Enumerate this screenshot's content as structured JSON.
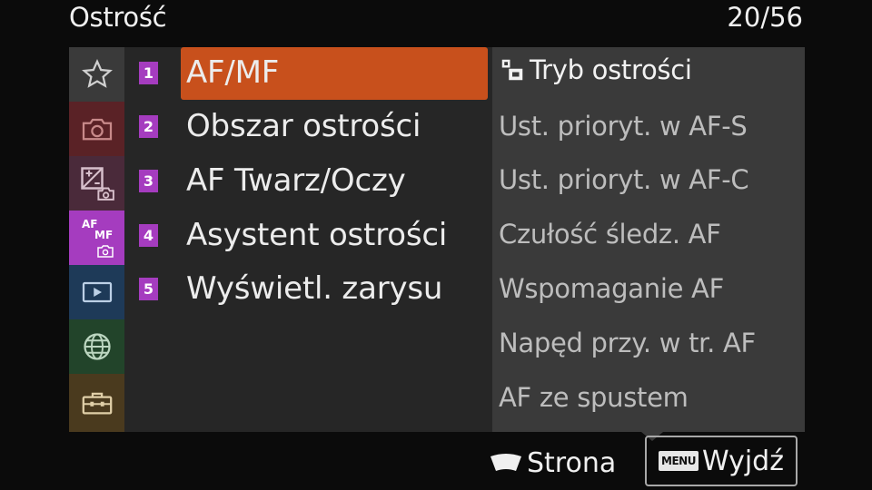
{
  "header": {
    "title": "Ostrość",
    "page": "20/56"
  },
  "tabs": [
    {
      "icon": "star-icon",
      "color": "#3a3a3a"
    },
    {
      "icon": "camera-icon",
      "color": "#5a2226"
    },
    {
      "icon": "exposure-camera-icon",
      "color": "#4a2a3a"
    },
    {
      "icon": "af-mf-camera-icon",
      "color": "#a53cbf",
      "selected": true,
      "label_top": "AF",
      "label_bottom": "MF"
    },
    {
      "icon": "playback-icon",
      "color": "#1e3a58"
    },
    {
      "icon": "globe-icon",
      "color": "#22442a"
    },
    {
      "icon": "toolbox-icon",
      "color": "#4a3a1e"
    }
  ],
  "menu": {
    "items": [
      {
        "num": "1",
        "label": "AF/MF"
      },
      {
        "num": "2",
        "label": "Obszar ostrości"
      },
      {
        "num": "3",
        "label": "AF Twarz/Oczy"
      },
      {
        "num": "4",
        "label": "Asystent ostrości"
      },
      {
        "num": "5",
        "label": "Wyświetl. zarysu"
      }
    ]
  },
  "submenu": {
    "items": [
      "Tryb ostrości",
      "Ust. prioryt. w AF-S",
      "Ust. prioryt. w AF-C",
      "Czułość śledz. AF",
      "Wspomaganie AF",
      "Napęd przy. w tr. AF",
      "AF ze spustem"
    ]
  },
  "footer": {
    "page_label": "Strona",
    "menu_badge": "MENU",
    "exit_label": "Wyjdź"
  },
  "colors": {
    "accent": "#c8501c",
    "category": "#a53cbf"
  }
}
